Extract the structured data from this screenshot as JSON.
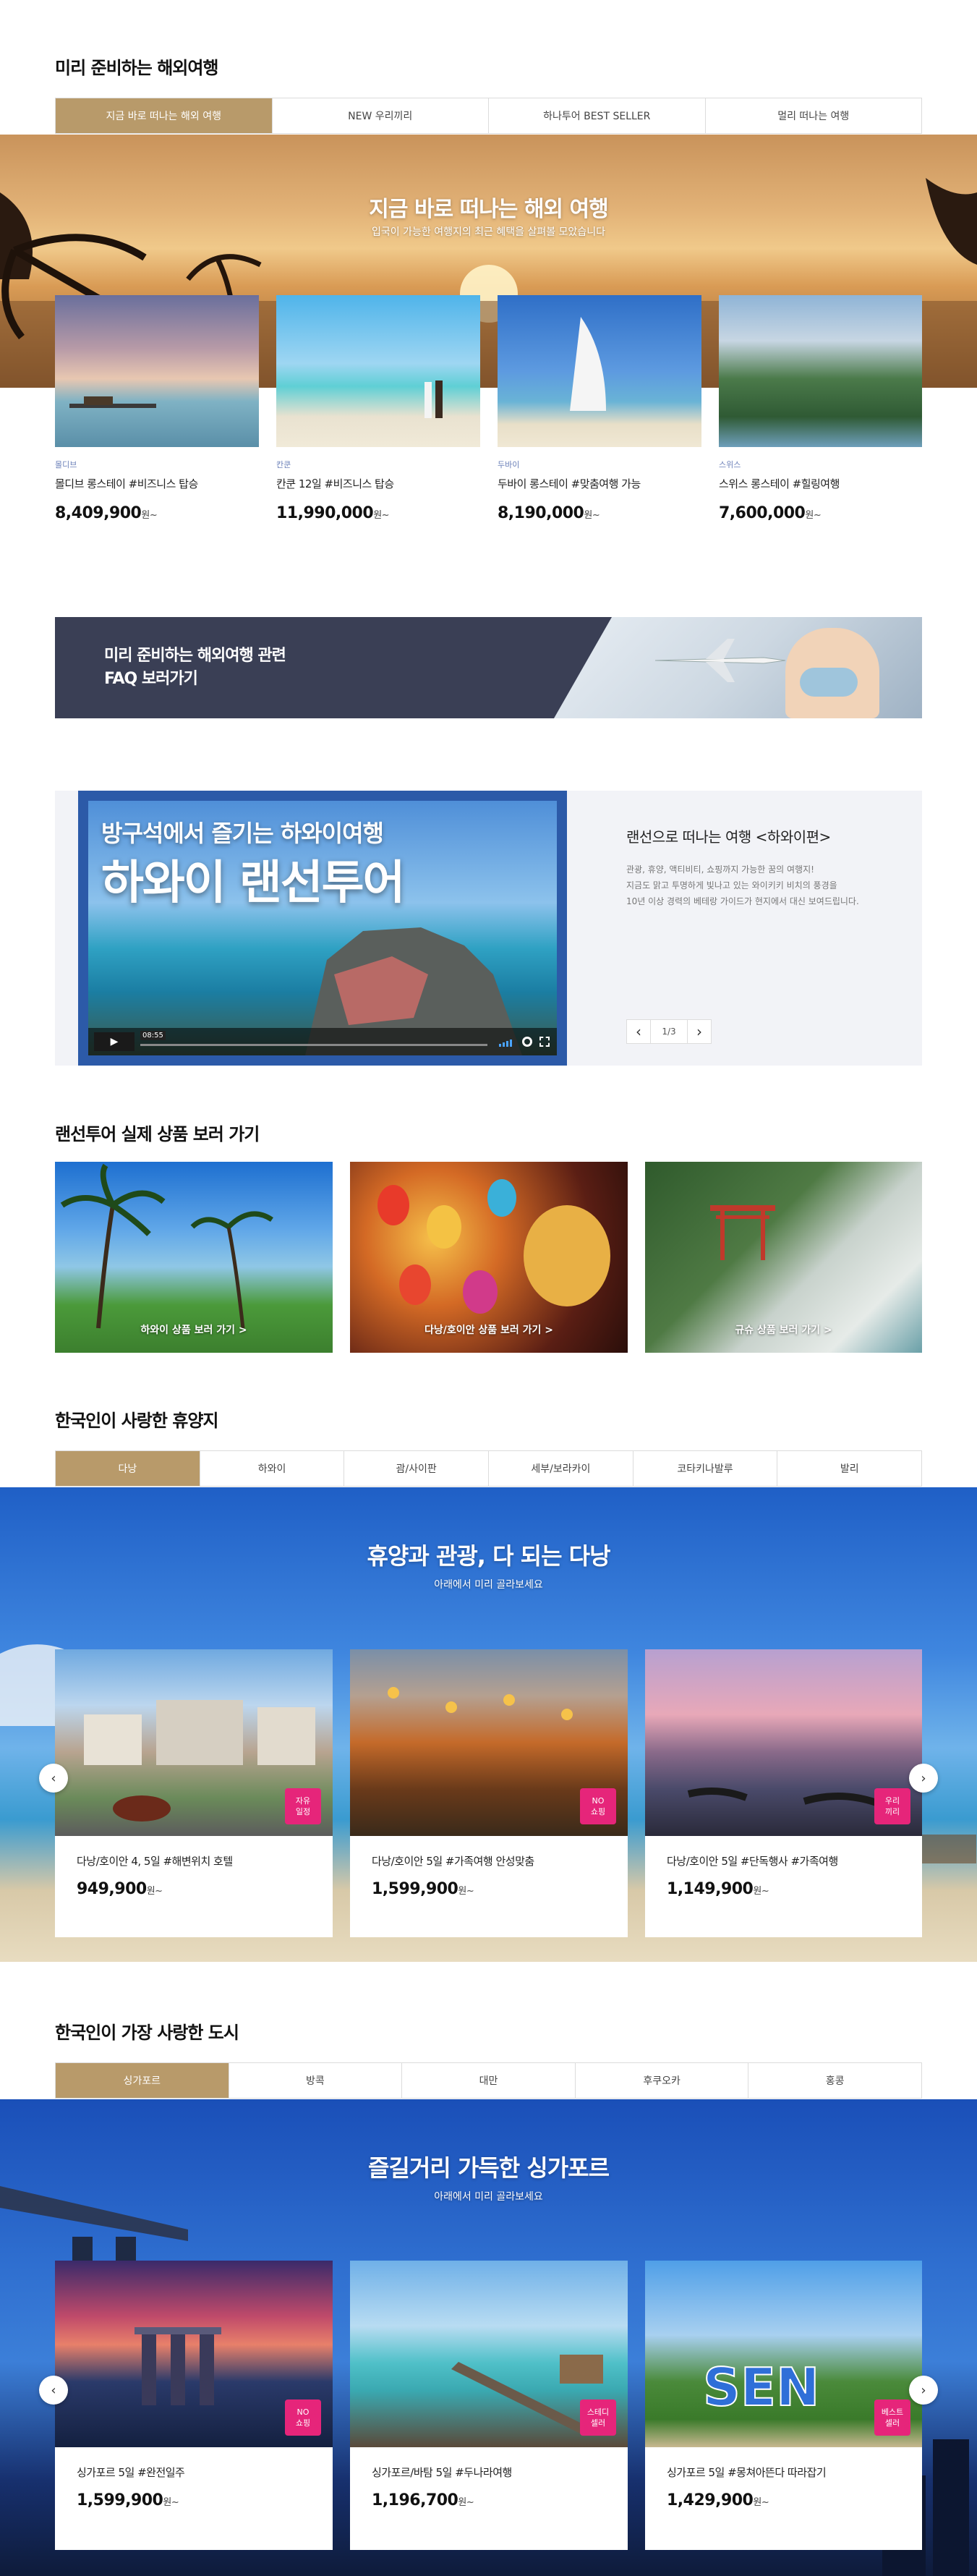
{
  "sec1": {
    "title": "미리 준비하는 해외여행",
    "tabs": [
      "지금 바로 떠나는 해외 여행",
      "NEW 우리끼리",
      "하나투어 BEST SELLER",
      "멀리 떠나는 여행"
    ],
    "banner_title": "지금 바로 떠나는 해외 여행",
    "banner_sub": "입국이 가능한 여행지의 최근 혜택을 살펴볼 모았습니다",
    "cards": [
      {
        "region": "몰디브",
        "name": "몰디브 롱스테이 #비즈니스 탑승",
        "price": "8,409,900",
        "unit": "원~"
      },
      {
        "region": "칸쿤",
        "name": "칸쿤 12일 #비즈니스 탑승",
        "price": "11,990,000",
        "unit": "원~"
      },
      {
        "region": "두바이",
        "name": "두바이 롱스테이 #맞춤여행 가능",
        "price": "8,190,000",
        "unit": "원~"
      },
      {
        "region": "스위스",
        "name": "스위스 롱스테이 #힐링여행",
        "price": "7,600,000",
        "unit": "원~"
      }
    ]
  },
  "faq": {
    "line1": "미리 준비하는 해외여행 관련",
    "line2": "FAQ 보러가기"
  },
  "video": {
    "title_small": "방구석에서 즐기는 하와이여행",
    "title_big": "하와이 랜선투어",
    "time": "08:55",
    "side_title": "랜선으로 떠나는 여행 <하와이편>",
    "desc1": "관광, 휴양, 액티비티, 쇼핑까지 가능한 꿈의 여행지!",
    "desc2": "지금도 맑고 투명하게 빛나고 있는 와이키키 비치의 풍경을",
    "desc3": "10년 이상 경력의 베테랑 가이드가 현지에서 대신 보여드립니다.",
    "pager": "1/3"
  },
  "lantour": {
    "title": "랜선투어 실제 상품 보러 가기",
    "items": [
      "하와이 상품 보러 가기 >",
      "다낭/호이안 상품 보러 가기 >",
      "규슈 상품 보러 가기 >"
    ]
  },
  "resort": {
    "title": "한국인이 사랑한 휴양지",
    "tabs": [
      "다낭",
      "하와이",
      "괌/사이판",
      "세부/보라카이",
      "코타키나발루",
      "발리"
    ],
    "band_title": "휴양과 관광, 다 되는 다낭",
    "band_sub": "아래에서 미리 골라보세요",
    "cards": [
      {
        "name": "다낭/호이안 4, 5일 #해변위치 호텔",
        "price": "949,900",
        "unit": "원~",
        "badge": "자유\n일정"
      },
      {
        "name": "다낭/호이안 5일 #가족여행 안성맞춤",
        "price": "1,599,900",
        "unit": "원~",
        "badge": "NO\n쇼핑"
      },
      {
        "name": "다낭/호이안 5일 #단독행사 #가족여행",
        "price": "1,149,900",
        "unit": "원~",
        "badge": "우리\n끼리"
      }
    ]
  },
  "city": {
    "title": "한국인이 가장 사랑한 도시",
    "tabs": [
      "싱가포르",
      "방콕",
      "대만",
      "후쿠오카",
      "홍콩"
    ],
    "band_title": "즐길거리 가득한 싱가포르",
    "band_sub": "아래에서 미리 골라보세요",
    "cards": [
      {
        "name": "싱가포르 5일 #완전일주",
        "price": "1,599,900",
        "unit": "원~",
        "badge": "NO\n쇼핑"
      },
      {
        "name": "싱가포르/바탐 5일 #두나라여행",
        "price": "1,196,700",
        "unit": "원~",
        "badge": "스테디\n셀러"
      },
      {
        "name": "싱가포르 5일 #몽쳐아뜬다 따라잡기",
        "price": "1,429,900",
        "unit": "원~",
        "badge": "베스트\n셀러"
      }
    ]
  },
  "icons": {
    "prev": "‹",
    "next": "›",
    "play": "▶"
  }
}
